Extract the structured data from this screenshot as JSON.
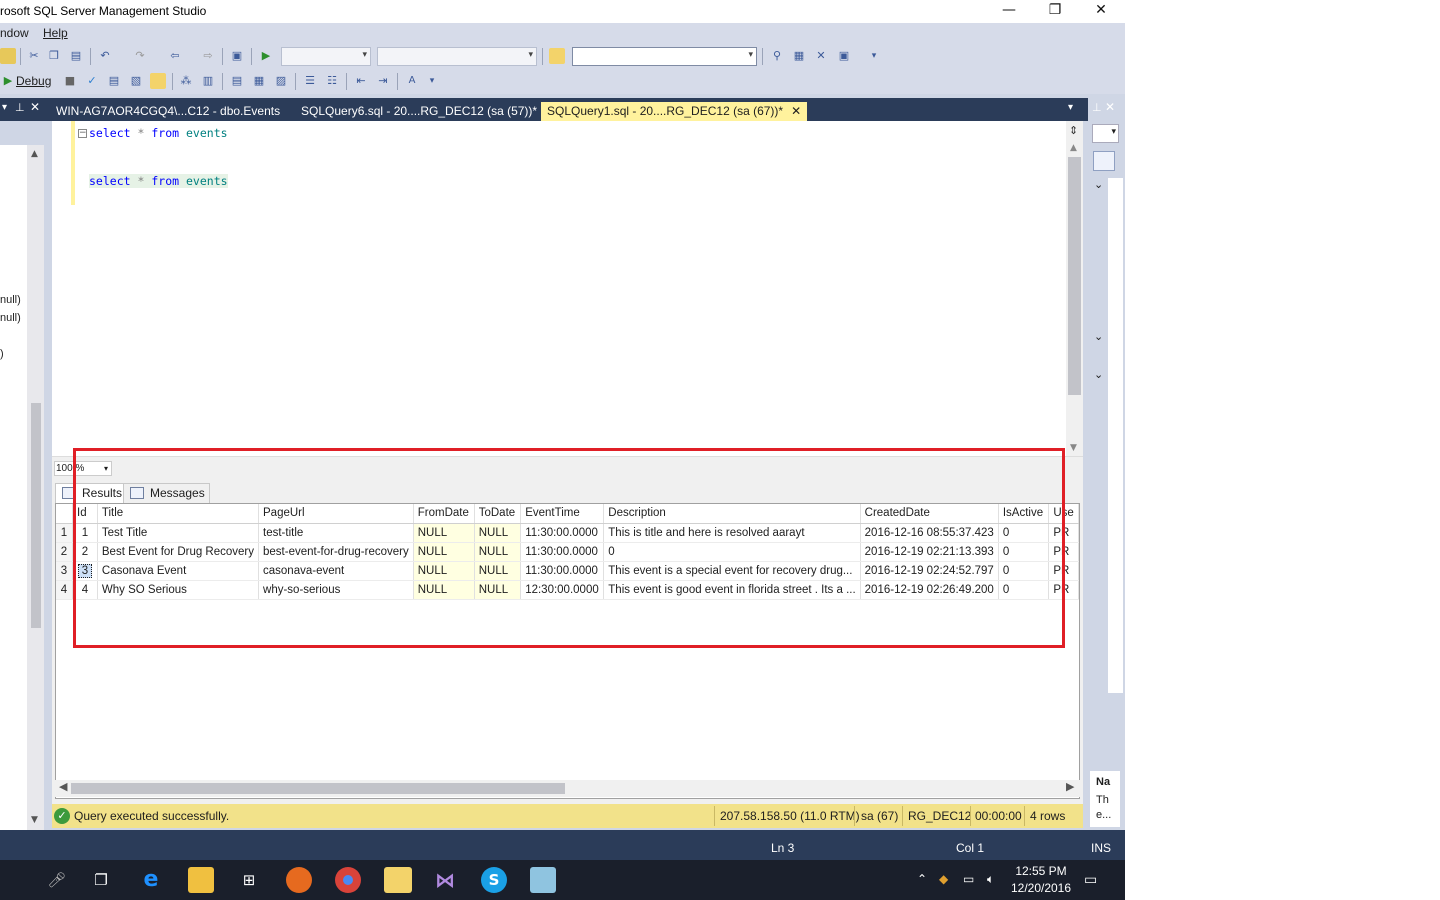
{
  "window": {
    "title": "rosoft SQL Server Management Studio",
    "minimize": "—",
    "restore": "❐",
    "close": "✕"
  },
  "menu": {
    "items": [
      "ndow",
      "Help"
    ]
  },
  "toolbar2": {
    "debug_label": "Debug"
  },
  "tabs": [
    {
      "label": "WIN-AG7AOR4CGQ4\\...C12 - dbo.Events",
      "active": false
    },
    {
      "label": "SQLQuery6.sql - 20....RG_DEC12 (sa (57))*",
      "active": false
    },
    {
      "label": "SQLQuery1.sql - 20....RG_DEC12 (sa (67))*",
      "active": true
    }
  ],
  "left_panel": {
    "fragments": [
      "null)",
      "null)",
      ")"
    ]
  },
  "editor": {
    "lines": [
      {
        "kw1": "select",
        "op": "*",
        "kw2": "from",
        "ident": "events"
      },
      {
        "kw1": "select",
        "op": "*",
        "kw2": "from",
        "ident": "events"
      }
    ],
    "zoom": "100 %"
  },
  "results": {
    "tabs": {
      "results": "Results",
      "messages": "Messages"
    },
    "columns": [
      "Id",
      "Title",
      "PageUrl",
      "FromDate",
      "ToDate",
      "EventTime",
      "Description",
      "CreatedDate",
      "IsActive",
      "Use"
    ],
    "rows": [
      {
        "rn": "1",
        "id": "1",
        "title": "Test Title",
        "pageurl": "test-title",
        "fromdate": "NULL",
        "todate": "NULL",
        "eventtime": "11:30:00.0000",
        "description": "This is title and here is resolved aarayt",
        "createddate": "2016-12-16 08:55:37.423",
        "isactive": "0",
        "use": "PR"
      },
      {
        "rn": "2",
        "id": "2",
        "title": "Best Event for Drug Recovery",
        "pageurl": "best-event-for-drug-recovery",
        "fromdate": "NULL",
        "todate": "NULL",
        "eventtime": "11:30:00.0000",
        "description": "0",
        "createddate": "2016-12-19 02:21:13.393",
        "isactive": "0",
        "use": "PR"
      },
      {
        "rn": "3",
        "id": "3",
        "title": "Casonava Event",
        "pageurl": "casonava-event",
        "fromdate": "NULL",
        "todate": "NULL",
        "eventtime": "11:30:00.0000",
        "description": "This event is  a special event for recovery drug...",
        "createddate": "2016-12-19 02:24:52.797",
        "isactive": "0",
        "use": "PR"
      },
      {
        "rn": "4",
        "id": "4",
        "title": "Why SO Serious",
        "pageurl": "why-so-serious",
        "fromdate": "NULL",
        "todate": "NULL",
        "eventtime": "12:30:00.0000",
        "description": "This event is good event in florida street . Its a ...",
        "createddate": "2016-12-19 02:26:49.200",
        "isactive": "0",
        "use": "PR"
      }
    ]
  },
  "query_status": {
    "message": "Query executed successfully.",
    "server": "207.58.158.50 (11.0 RTM)",
    "user": "sa (67)",
    "database": "RG_DEC12",
    "elapsed": "00:00:00",
    "row_count": "4 rows"
  },
  "right_panel": {
    "label1": "Na",
    "label2": "Th",
    "label3": "e..."
  },
  "app_status": {
    "line": "Ln 3",
    "col": "Col 1",
    "mode": "INS"
  },
  "taskbar": {
    "time": "12:55 PM",
    "date": "12/20/2016"
  },
  "colors": {
    "tab_active": "#fff29d",
    "status_yellow": "#f2e28a",
    "dark_blue": "#2b3c59",
    "highlight_red": "#e01f26"
  }
}
